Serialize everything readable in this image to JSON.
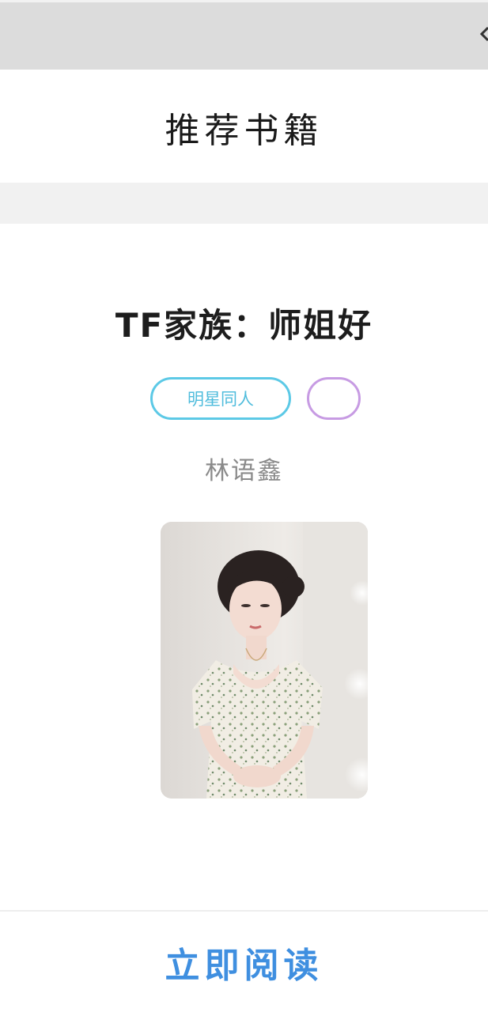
{
  "header": {
    "title": "推荐书籍"
  },
  "book": {
    "title": "TF家族：师姐好",
    "tags": [
      {
        "label": "明星同人",
        "color": "#4fbcdc"
      },
      {
        "label": "",
        "color": "#c79be3"
      }
    ],
    "author": "林语鑫",
    "cover_icon": "book-cover-photo"
  },
  "actions": {
    "read_now_label": "立即阅读"
  },
  "icons": {
    "back": "back-chevron-icon"
  },
  "colors": {
    "accent": "#3f8fe0",
    "top_bar": "#dcdcdc",
    "band": "#f1f1f1"
  }
}
